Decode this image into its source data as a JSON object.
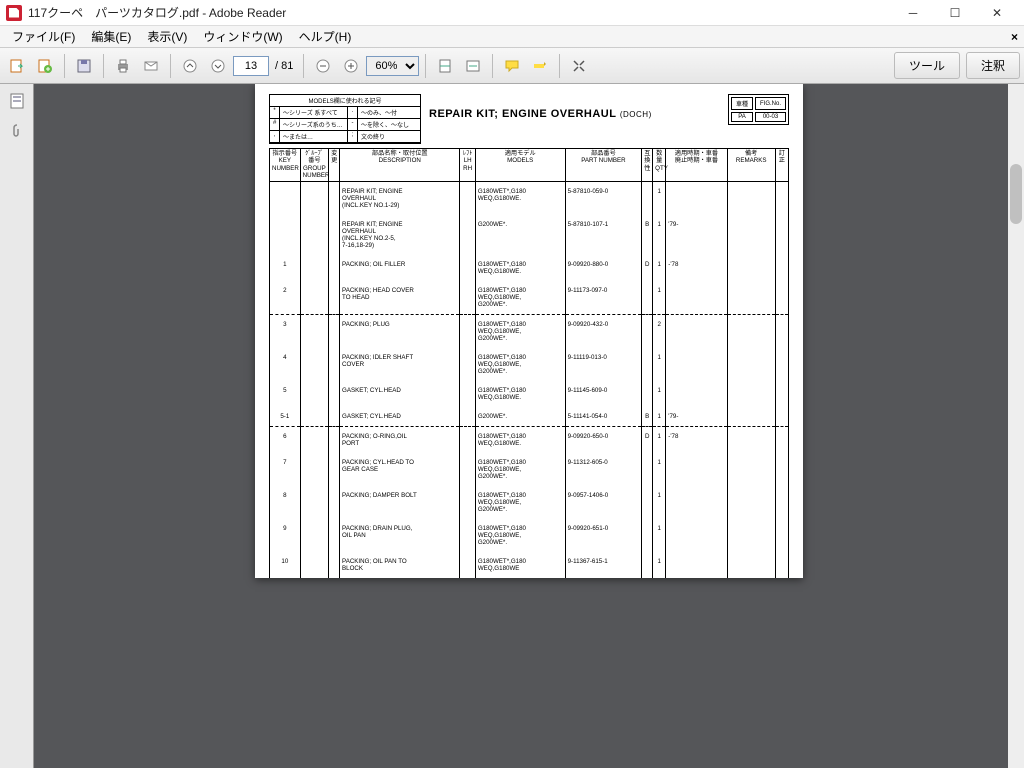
{
  "window": {
    "title": "117クーペ　パーツカタログ.pdf - Adobe Reader"
  },
  "menu": {
    "file": "ファイル(F)",
    "edit": "編集(E)",
    "view": "表示(V)",
    "window": "ウィンドウ(W)",
    "help": "ヘルプ(H)"
  },
  "toolbar": {
    "page_current": "13",
    "page_total": "/ 81",
    "zoom": "60%",
    "tools": "ツール",
    "comment": "注釈"
  },
  "doc": {
    "models_title": "MODELS欄に使われる記号",
    "models_rows": [
      [
        "*",
        "～シリーズ 系すべて",
        ".",
        "～のみ、～付"
      ],
      [
        "#",
        "～シリーズ系のうち…",
        "-",
        "～を除く、～なし"
      ],
      [
        ",",
        "～または…",
        ";",
        "文の終り"
      ]
    ],
    "title_main": "REPAIR KIT; ENGINE OVERHAUL",
    "title_sub": "(DOCH)",
    "figbox": {
      "h1": "車種",
      "h2": "FIG.No.",
      "v1": "PA",
      "v2": "00-03"
    },
    "headers": {
      "key": "指示番号\nKEY\nNUMBER",
      "grp": "ｸﾞﾙｰﾌﾟ番号\nGROUP\nNUMBER",
      "chg": "変更",
      "desc": "部品名称・取付位置\nDESCRIPTION",
      "lr": "ﾚﾌﾄ\nLH\nRH",
      "mdl": "適用モデル\nMODELS",
      "pn": "部品番号\nPART NUMBER",
      "itc": "互換性",
      "qty": "数量\nQTY",
      "date": "適用時期・車番\n廃止時期・車番",
      "rmk": "備考\nREMARKS",
      "rev": "訂正"
    },
    "rows": [
      {
        "key": "",
        "desc": "REPAIR KIT; ENGINE\n OVERHAUL\n  (INCL.KEY NO.1-29)",
        "mdl": "G180WET*,G180\nWEQ,G180WE.",
        "pn": "5-87810-059-0",
        "itc": "",
        "qty": "1",
        "date": "",
        "rmk": ""
      },
      {
        "key": "",
        "desc": "REPAIR KIT; ENGINE\n OVERHAUL\n  (INCL.KEY NO.2-5,\n  7-16,18-29)",
        "mdl": "G200WE*.",
        "pn": "5-87810-107-1",
        "itc": "B",
        "qty": "1",
        "date": "'79-",
        "rmk": ""
      },
      {
        "key": "1",
        "desc": "PACKING; OIL FILLER",
        "mdl": "G180WET*,G180\nWEQ,G180WE.",
        "pn": "9-09920-880-0",
        "itc": "D",
        "qty": "1",
        "date": "-'78",
        "rmk": ""
      },
      {
        "key": "2",
        "desc": "PACKING; HEAD COVER\n TO HEAD",
        "mdl": "G180WET*,G180\nWEQ,G180WE,\nG200WE*.",
        "pn": "9-11173-097-0",
        "itc": "",
        "qty": "1",
        "date": "",
        "rmk": ""
      },
      {
        "sep": true
      },
      {
        "key": "3",
        "desc": "PACKING; PLUG",
        "mdl": "G180WET*,G180\nWEQ,G180WE,\nG200WE*.",
        "pn": "9-09920-432-0",
        "itc": "",
        "qty": "2",
        "date": "",
        "rmk": ""
      },
      {
        "key": "4",
        "desc": "PACKING; IDLER SHAFT\n COVER",
        "mdl": "G180WET*,G180\nWEQ,G180WE,\nG200WE*.",
        "pn": "9-11119-013-0",
        "itc": "",
        "qty": "1",
        "date": "",
        "rmk": ""
      },
      {
        "key": "5",
        "desc": "GASKET; CYL.HEAD",
        "mdl": "G180WET*,G180\nWEQ,G180WE.",
        "pn": "9-11145-609-0",
        "itc": "",
        "qty": "1",
        "date": "",
        "rmk": ""
      },
      {
        "key": "5-1",
        "desc": "GASKET; CYL.HEAD",
        "mdl": "G200WE*.",
        "pn": "5-11141-054-0",
        "itc": "B",
        "qty": "1",
        "date": "'79-",
        "rmk": ""
      },
      {
        "sep": true
      },
      {
        "key": "6",
        "desc": "PACKING; O-RING,OIL\n PORT",
        "mdl": "G180WET*,G180\nWEQ,G180WE.",
        "pn": "9-09920-650-0",
        "itc": "D",
        "qty": "1",
        "date": "-'78",
        "rmk": ""
      },
      {
        "key": "7",
        "desc": "PACKING; CYL.HEAD TO\n GEAR CASE",
        "mdl": "G180WET*,G180\nWEQ,G180WE,\nG200WE*.",
        "pn": "9-11312-605-0",
        "itc": "",
        "qty": "1",
        "date": "",
        "rmk": ""
      },
      {
        "key": "8",
        "desc": "PACKING; DAMPER BOLT",
        "mdl": "G180WET*,G180\nWEQ,G180WE,\nG200WE*.",
        "pn": "9-0957-1406-0",
        "itc": "",
        "qty": "1",
        "date": "",
        "rmk": ""
      },
      {
        "key": "9",
        "desc": "PACKING; DRAIN PLUG,\n OIL PAN",
        "mdl": "G180WET*,G180\nWEQ,G180WE,\nG200WE*.",
        "pn": "9-09920-651-0",
        "itc": "",
        "qty": "1",
        "date": "",
        "rmk": ""
      },
      {
        "key": "10",
        "desc": "PACKING; OIL PAN TO\n BLOCK",
        "mdl": "G180WET*,G180\nWEQ,G180WE",
        "pn": "9-11367-615-1",
        "itc": "",
        "qty": "1",
        "date": "",
        "rmk": ""
      }
    ]
  }
}
